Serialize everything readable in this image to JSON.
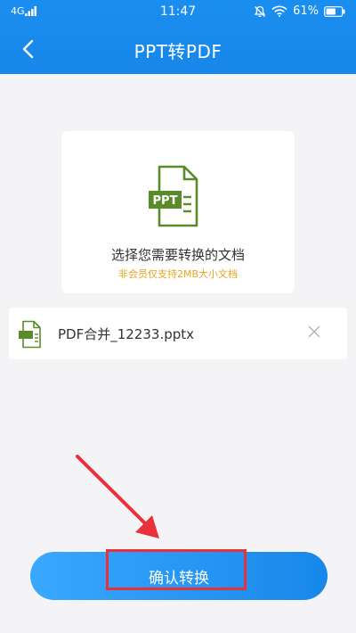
{
  "status_bar": {
    "network": "4G",
    "time": "11:47",
    "battery": "61%"
  },
  "header": {
    "title": "PPT转PDF"
  },
  "upload_card": {
    "icon_label": "PPT",
    "prompt": "选择您需要转换的文档",
    "notice": "非会员仅支持2MB大小文档"
  },
  "file_item": {
    "name": "PDF合并_12233.pptx"
  },
  "confirm_button": {
    "label": "确认转换"
  },
  "colors": {
    "header_blue": "#1787ea",
    "icon_green": "#5a8a2a",
    "notice_yellow": "#e6a521",
    "annotation_red": "#e8313a"
  }
}
